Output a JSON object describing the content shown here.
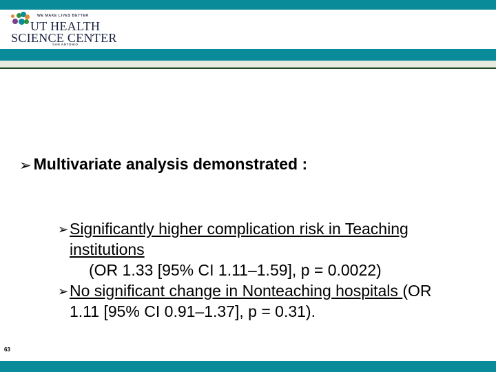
{
  "colors": {
    "teal": "#0a8b99",
    "beige": "#e9eae0",
    "green_rule": "#1d4720",
    "text": "#000000"
  },
  "header": {
    "logo": {
      "tagline": "WE MAKE LIVES BETTER",
      "line1": "UT HEALTH",
      "line2": "SCIENCE CENTER",
      "registered_mark": "·",
      "sublocation": "SAN ANTONIO",
      "dot_colors": [
        "#7b3f8c",
        "#2f8f3e",
        "#0a8b99",
        "#e08a2e",
        "#0a8b99",
        "#2f8f3e",
        "#e08a2e"
      ]
    }
  },
  "body": {
    "level1": {
      "bullet": "➢",
      "text": "Multivariate analysis demonstrated :"
    },
    "level2": [
      {
        "bullet": "➢",
        "underlined_text": "Significantly higher complication risk in Teaching institutions",
        "stat": "(OR 1.33 [95% CI 1.11–1.59], p = 0.0022)"
      },
      {
        "bullet": "➢",
        "underlined_text": "No significant change in Nonteaching hospitals ",
        "stat": "(OR 1.11 [95% CI 0.91–1.37], p = 0.31)."
      }
    ]
  },
  "footer": {
    "page_number": "63"
  }
}
